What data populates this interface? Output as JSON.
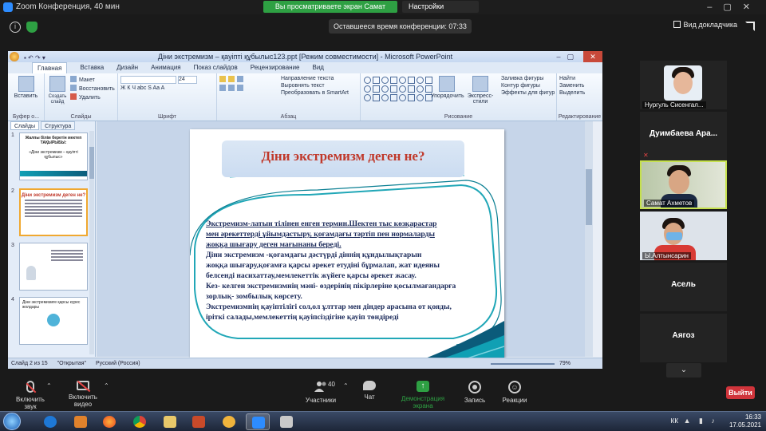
{
  "zoom": {
    "window_title": "Zoom Конференция, 40 мин",
    "share_banner": "Вы просматриваете экран Самат Ахметов",
    "view_settings": "Настройки просмотра ⌄",
    "time_left": "Оставшееся время конференции: 07:33",
    "view_mode": "Вид докладчика"
  },
  "ppt": {
    "window_title": "Діни экстремизм – қауіпті құбылыс123.ppt [Режим совместимости] - Microsoft PowerPoint",
    "tabs": [
      "Главная",
      "Вставка",
      "Дизайн",
      "Анимация",
      "Показ слайдов",
      "Рецензирование",
      "Вид"
    ],
    "ribbon": {
      "paste": "Вставить",
      "clipboard_group": "Буфер о...",
      "layout": "Макет",
      "reset": "Восстановить",
      "create_slide": "Создать слайд",
      "delete": "Удалить",
      "slides_group": "Слайды",
      "font_group": "Шрифт",
      "font_size": "24",
      "paragraph_group": "Абзац",
      "text_direction": "Направление текста",
      "align_text": "Выровнять текст",
      "smartart": "Преобразовать в SmartArt",
      "arrange": "Упорядочить",
      "express_styles": "Экспресс-стили",
      "shape_fill": "Заливка фигуры",
      "shape_outline": "Контур фигуры",
      "shape_effects": "Эффекты для фигур",
      "drawing_group": "Рисование",
      "find": "Найти",
      "replace": "Заменить",
      "select": "Выделить",
      "editing_group": "Редактирование"
    },
    "pane_tabs": [
      "Слайды",
      "Структура"
    ],
    "thumbnails": [
      {
        "num": "1",
        "title": "Жалпы білім беретін мектеп ТАҚЫРЫБЫ:",
        "subtitle": "«Діни экстремизм – қауіпті құбылыс»"
      },
      {
        "num": "2",
        "title": "Діни экстремизм деген не?"
      },
      {
        "num": "3"
      },
      {
        "num": "4",
        "title": "Діни экстремизмге қарсы күрес жолдары"
      }
    ],
    "slide": {
      "title": "Діни экстремизм деген не?",
      "lines": [
        "Экстремизм-латын тілінен енген термин.Шектен тыс көзқарастар",
        "мен әрекеттерді ұйымдастыру, қоғамдағы тәртіп пен нормаларды",
        "жоққа шығару деген  мағынаны береді.",
        "Діни экстремизм -қоғамдағы дәстүрді діннің құндылықтарын",
        " жоққа шығару,қоғамға қарсы әрекет етудіні бұрмалап, жат  идеяны",
        " белсенді насихаттау,мемлекеттік жүйеге қарсы әрекет жасау.",
        "Кез- келген экстремизмнің мәні- өздерінің пікірлеріне  қосылмағандарға",
        " зорлық- зомбылық көрсету.",
        "Экстремизмнің қауіптілігі сол,ол ұлттар мен діндер арасына от қояды,",
        "іріткі салады,мемлекеттің қауіпсіздігіне қауіп төндіреді"
      ]
    },
    "status": {
      "slide_counter": "Слайд 2 из 15",
      "theme": "\"Открытая\"",
      "language": "Русский (Россия)",
      "zoom": "79%"
    }
  },
  "participants": [
    {
      "name": "Нургуль Сисенгал...",
      "type": "photo"
    },
    {
      "name": "Дуимбаева  Ара...",
      "type": "name"
    },
    {
      "name": "Самат Ахметов",
      "type": "photo",
      "active": true
    },
    {
      "name": "Ы.Алтынсарин",
      "type": "photo"
    },
    {
      "name": "Асель",
      "type": "name"
    },
    {
      "name": "Аягоз",
      "type": "name"
    }
  ],
  "controls": {
    "mic": "Включить звук",
    "video": "Включить видео",
    "participants": "Участники",
    "participants_count": "40",
    "chat": "Чат",
    "share": "Демонстрация экрана",
    "record": "Запись",
    "reactions": "Реакции",
    "leave": "Выйти"
  },
  "taskbar": {
    "lang": "КК",
    "time": "16:33",
    "date": "17.05.2021"
  },
  "colors": {
    "share_green": "#2ea043",
    "slide_title_red": "#c0392b",
    "slide_text_navy": "#1b2a5a",
    "leave_red": "#d0343b"
  }
}
